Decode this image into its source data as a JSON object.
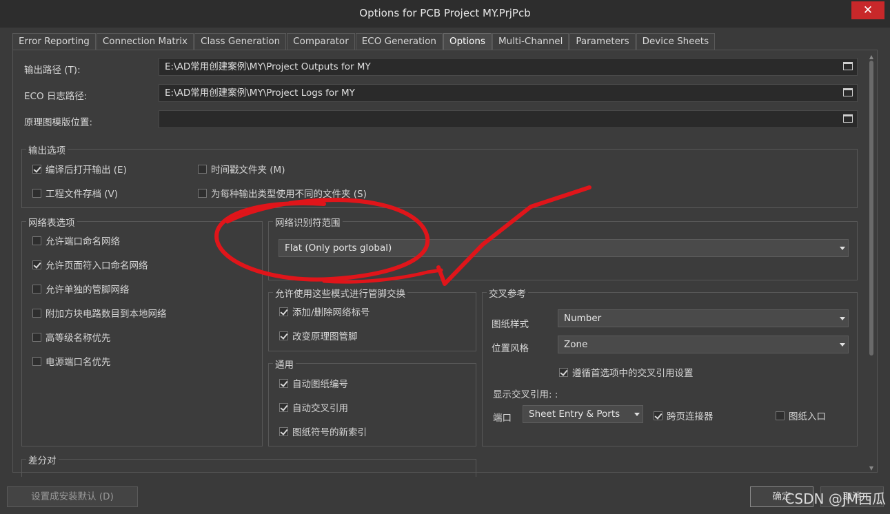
{
  "window": {
    "title": "Options for PCB Project MY.PrjPcb",
    "close_label": "✕"
  },
  "tabs": [
    {
      "label": "Error Reporting"
    },
    {
      "label": "Connection Matrix"
    },
    {
      "label": "Class Generation"
    },
    {
      "label": "Comparator"
    },
    {
      "label": "ECO Generation"
    },
    {
      "label": "Options"
    },
    {
      "label": "Multi-Channel"
    },
    {
      "label": "Parameters"
    },
    {
      "label": "Device Sheets"
    }
  ],
  "paths": {
    "output_label": "输出路径 (T):",
    "output_value": "E:\\AD常用创建案例\\MY\\Project Outputs for MY",
    "eco_label": "ECO 日志路径:",
    "eco_value": "E:\\AD常用创建案例\\MY\\Project Logs for MY",
    "template_label": "原理图模版位置:",
    "template_value": ""
  },
  "output_options": {
    "title": "输出选项",
    "open_after_compile": {
      "label": "编译后打开输出 (E)",
      "checked": true
    },
    "timestamp_folder": {
      "label": "时间戳文件夹 (M)",
      "checked": false
    },
    "archive_project": {
      "label": "工程文件存档 (V)",
      "checked": false
    },
    "separate_folders": {
      "label": "为每种输出类型使用不同的文件夹 (S)",
      "checked": false
    }
  },
  "netlist_options": {
    "title": "网络表选项",
    "items": [
      {
        "label": "允许端口命名网络",
        "checked": false
      },
      {
        "label": "允许页面符入口命名网络",
        "checked": true
      },
      {
        "label": "允许单独的管脚网络",
        "checked": false
      },
      {
        "label": "附加方块电路数目到本地网络",
        "checked": false
      },
      {
        "label": "高等级名称优先",
        "checked": false
      },
      {
        "label": "电源端口名优先",
        "checked": false
      }
    ]
  },
  "net_identifier_scope": {
    "title": "网络识别符范围",
    "value": "Flat (Only ports global)"
  },
  "pin_swap": {
    "title": "允许使用这些模式进行管脚交换",
    "items": [
      {
        "label": "添加/删除网络标号",
        "checked": true
      },
      {
        "label": "改变原理图管脚",
        "checked": true
      }
    ]
  },
  "general": {
    "title": "通用",
    "items": [
      {
        "label": "自动图纸编号",
        "checked": true
      },
      {
        "label": "自动交叉引用",
        "checked": true
      },
      {
        "label": "图纸符号的新索引",
        "checked": true
      }
    ]
  },
  "cross_reference": {
    "title": "交叉参考",
    "sheet_style_label": "图纸样式",
    "sheet_style_value": "Number",
    "location_style_label": "位置风格",
    "location_style_value": "Zone",
    "follow_prefs": {
      "label": "遵循首选项中的交叉引用设置",
      "checked": true
    },
    "show_label": "显示交叉引用: :",
    "port_label": "端口",
    "port_value": "Sheet Entry & Ports",
    "offsheet": {
      "label": "跨页连接器",
      "checked": true
    },
    "sheet_entry": {
      "label": "图纸入口",
      "checked": false
    }
  },
  "diff_pair": {
    "title": "差分对"
  },
  "buttons": {
    "set_default": "设置成安装默认 (D)",
    "ok": "确定",
    "cancel": "取消"
  },
  "watermark": "CSDN @JM西瓜"
}
